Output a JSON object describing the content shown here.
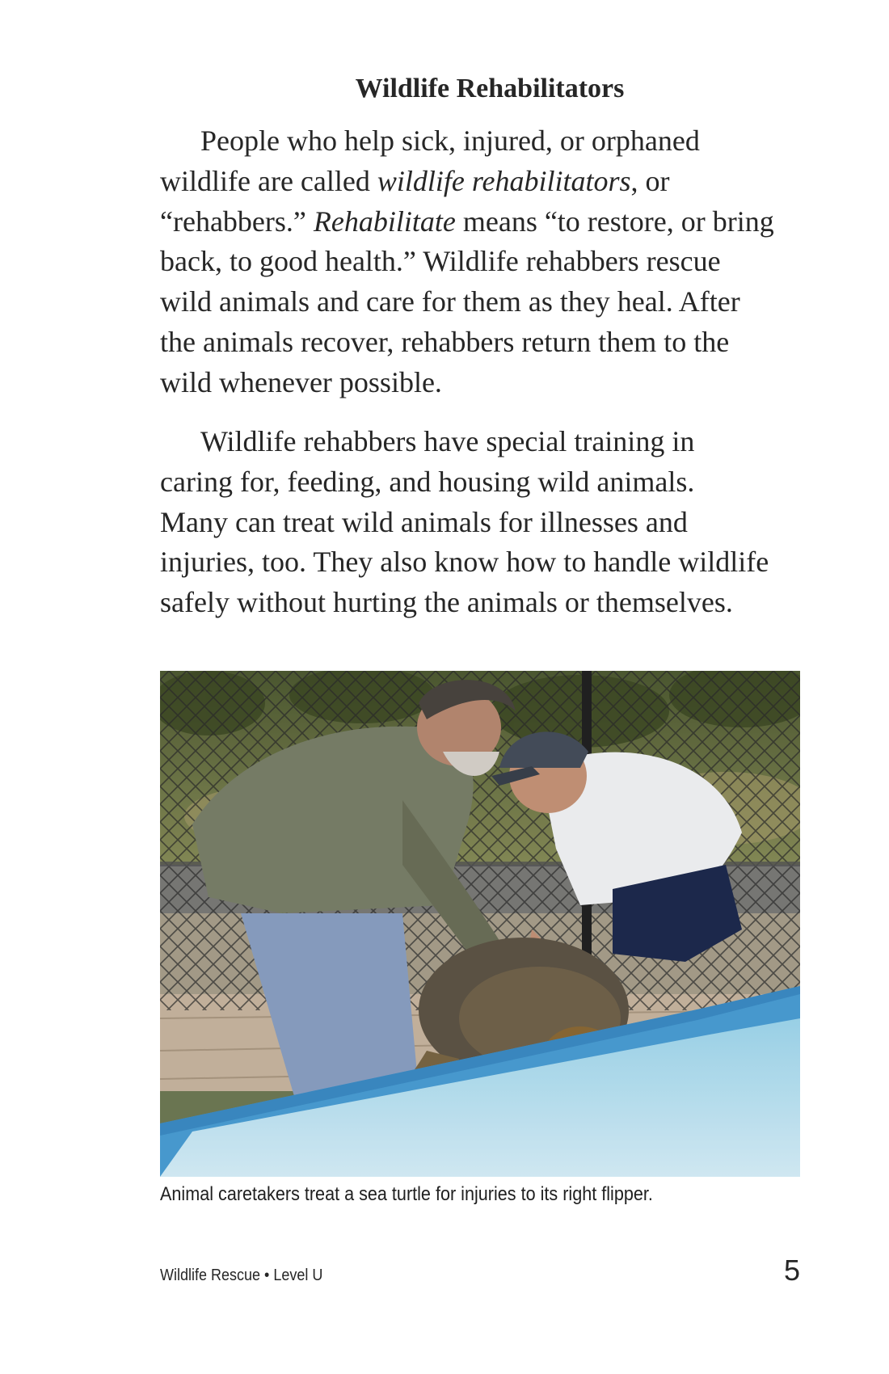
{
  "heading": "Wildlife Rehabilitators",
  "paragraph1": {
    "line1": "People who help sick, injured, or orphaned",
    "line2_a": "wildlife are called ",
    "line2_em": "wildlife rehabilitators",
    "line2_b": ", or",
    "line3_a": "“rehabbers.” ",
    "line3_em": "Rehabilitate",
    "line3_b": " means “to restore, or bring",
    "line4": "back, to good health.” Wildlife rehabbers rescue",
    "line5": "wild animals and care for them as they heal. After",
    "line6": "the animals recover, rehabbers return them to the",
    "line7": "wild whenever possible."
  },
  "paragraph2": {
    "line1": "Wildlife rehabbers have special training in",
    "line2": "caring for, feeding, and housing wild animals.",
    "line3": "Many can treat wild animals for illnesses and",
    "line4": "injuries, too. They also know how to handle wildlife",
    "line5": "safely without hurting the animals or themselves."
  },
  "caption": "Animal caretakers treat a sea turtle for injuries to its right flipper.",
  "footer": {
    "book_info": "Wildlife Rescue • Level U",
    "page_number": "5"
  }
}
